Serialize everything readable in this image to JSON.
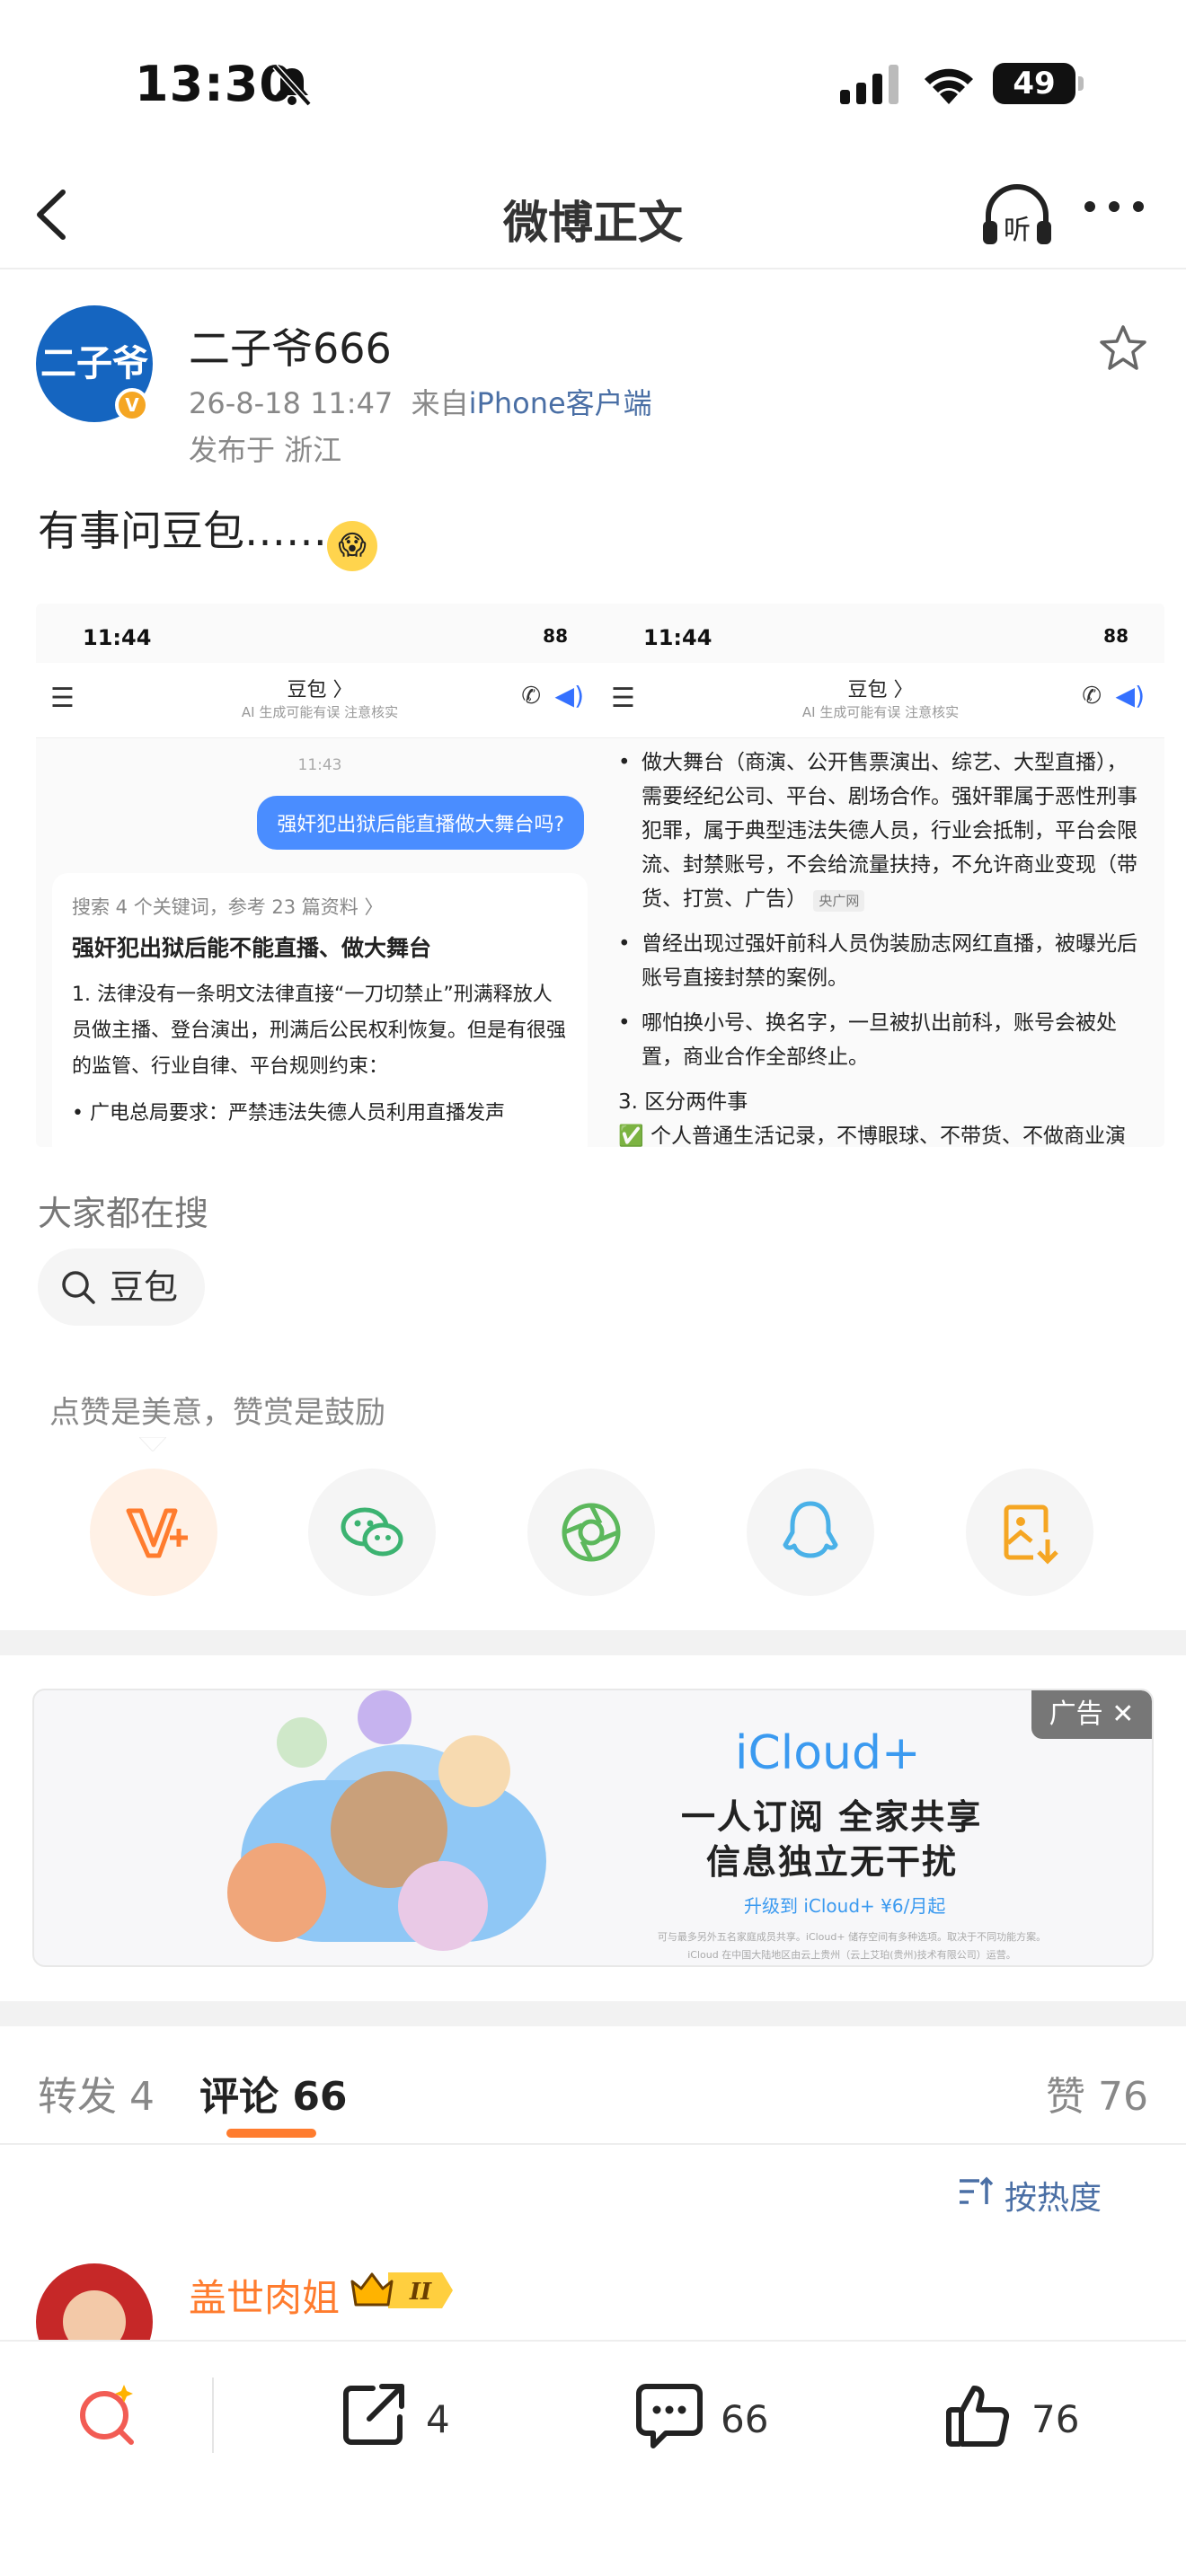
{
  "status_bar": {
    "time": "13:30",
    "battery": "49"
  },
  "nav": {
    "title": "微博正文"
  },
  "post": {
    "author": "二子爷666",
    "avatar_text": "二子爷",
    "timestamp": "26-8-18 11:47",
    "source_prefix": "来自",
    "source": "iPhone客户端",
    "location": "发布于 浙江",
    "text": "有事问豆包……"
  },
  "shot1": {
    "time": "11:44",
    "battery": "88",
    "title": "豆包 〉",
    "subtitle": "AI 生成可能有误 注意核实",
    "msg_time": "11:43",
    "question": "强奸犯出狱后能直播做大舞台吗?",
    "search_info": "搜索 4 个关键词，参考 23 篇资料 〉",
    "heading": "强奸犯出狱后能不能直播、做大舞台",
    "p1": "1. 法律没有一条明文法律直接“一刀切禁止”刑满释放人员做主播、登台演出，刑满后公民权利恢复。但是有很强的监管、行业自律、平台规则约束：",
    "p2": "• 广电总局要求：严禁违法失德人员利用直播发声"
  },
  "shot2": {
    "time": "11:44",
    "battery": "88",
    "title": "豆包 〉",
    "subtitle": "AI 生成可能有误 注意核实",
    "b1": "做大舞台（商演、公开售票演出、综艺、大型直播），需要经纪公司、平台、剧场合作。强奸罪属于恶性刑事犯罪，属于典型违法失德人员，行业会抵制，平台会限流、封禁账号，不会给流量扶持，不允许商业变现（带货、打赏、广告）",
    "b1_tag": "央广网",
    "b2": "曾经出现过强奸前科人员伪装励志网红直播，被曝光后账号直接封禁的案例。",
    "b3": "哪怕换小号、换名字，一旦被扒出前科，账号会被处置，商业合作全部终止。",
    "p3": "3. 区分两件事",
    "p3a": "✅ 个人普通生活记录，不博眼球、不带货、不做商业演出，法律层面不禁止；"
  },
  "search": {
    "heading": "大家都在搜",
    "chip": "豆包"
  },
  "appreciate": {
    "text": "点赞是美意，赞赏是鼓励"
  },
  "share_icons": [
    "v-plus-icon",
    "wechat-icon",
    "moments-icon",
    "qq-icon",
    "save-image-icon"
  ],
  "ad": {
    "tag": "广告",
    "logo": "iCloud+",
    "line1": "一人订阅 全家共享",
    "line2": "信息独立无干扰",
    "line3": "升级到 iCloud+ ¥6/月起",
    "fine1": "可与最多另外五名家庭成员共享。iCloud+ 储存空间有多种选项。取决于不同功能方案。",
    "fine2": "iCloud 在中国大陆地区由云上贵州（云上艾珀(贵州)技术有限公司）运营。"
  },
  "tabs": {
    "repost": "转发 4",
    "comments": "评论 66",
    "likes": "赞 76"
  },
  "sort": {
    "label": "按热度"
  },
  "comment": {
    "author": "盖世肉姐",
    "level": "II"
  },
  "tabbar": {
    "repost_count": "4",
    "comment_count": "66",
    "like_count": "76"
  },
  "colors": {
    "accent": "#ff7c2e",
    "link": "#4a6fa5",
    "blue": "#3b9af0"
  }
}
